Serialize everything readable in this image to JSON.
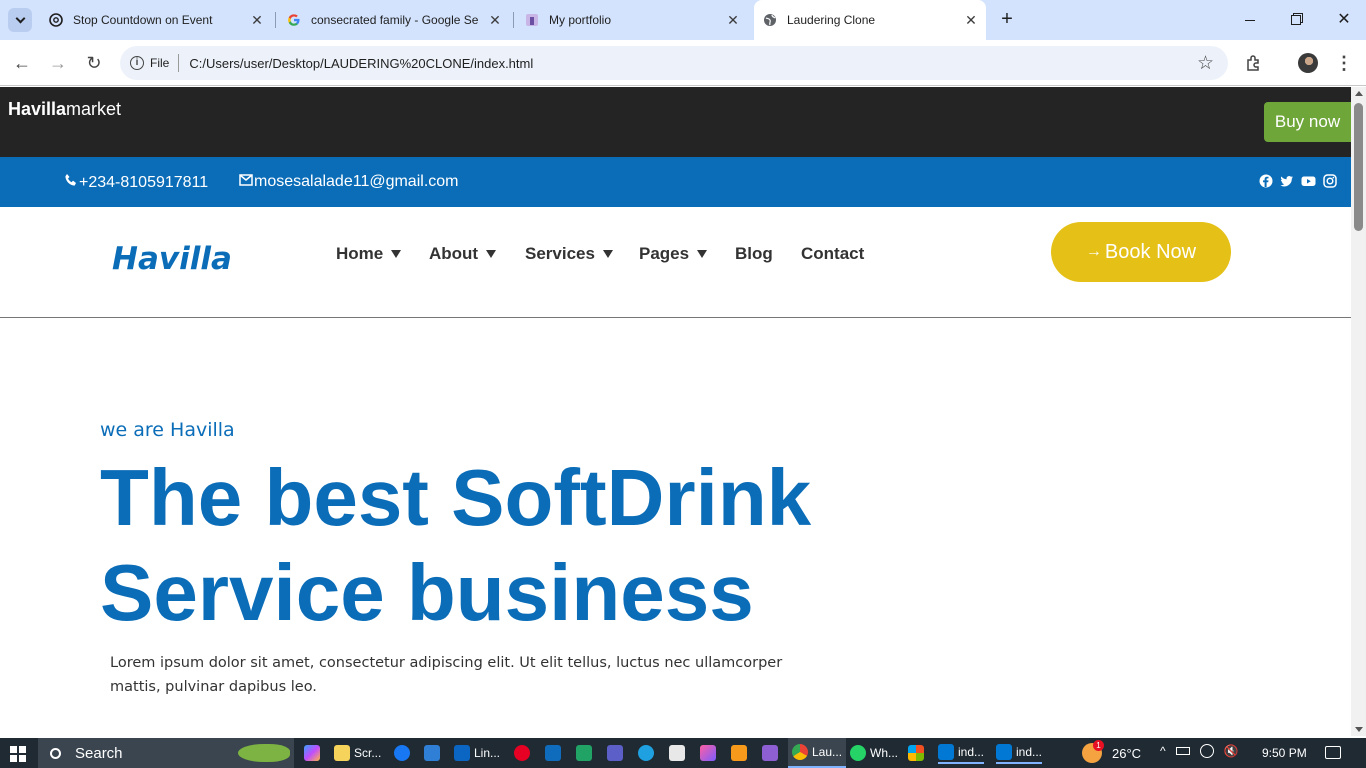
{
  "browser": {
    "tabs": [
      {
        "title": "Stop Countdown on Event",
        "active": false
      },
      {
        "title": "consecrated family - Google Se",
        "active": false
      },
      {
        "title": "My portfolio",
        "active": false
      },
      {
        "title": "Laudering Clone",
        "active": true
      }
    ],
    "scheme_label": "File",
    "url": "C:/Users/user/Desktop/LAUDERING%20CLONE/index.html"
  },
  "site": {
    "brand_bold": "Havilla",
    "brand_light": "market",
    "buy_now": "Buy now",
    "phone": "+234-8105917811",
    "email": "mosesalalade11@gmail.com",
    "logo": "Havilla",
    "nav": [
      "Home",
      "About",
      "Services",
      "Pages",
      "Blog",
      "Contact"
    ],
    "book_now": "Book Now",
    "hero": {
      "kicker": "we are Havilla",
      "title_line1": "The best SoftDrink",
      "title_line2": "Service business",
      "body": "Lorem ipsum dolor sit amet, consectetur adipiscing elit. Ut elit tellus, luctus nec ullamcorper mattis, pulvinar dapibus leo."
    },
    "colors": {
      "brand_blue": "#0b6db8",
      "accent_yellow": "#e5c016",
      "buy_green": "#6fa63a",
      "dark_bar": "#242424"
    }
  },
  "taskbar": {
    "search_label": "Search",
    "apps": [
      "Scr...",
      "Lin...",
      "Lau...",
      "Wh...",
      "ind...",
      "ind..."
    ],
    "notification_count": "1",
    "temperature": "26°C",
    "time": "9:50 PM"
  }
}
